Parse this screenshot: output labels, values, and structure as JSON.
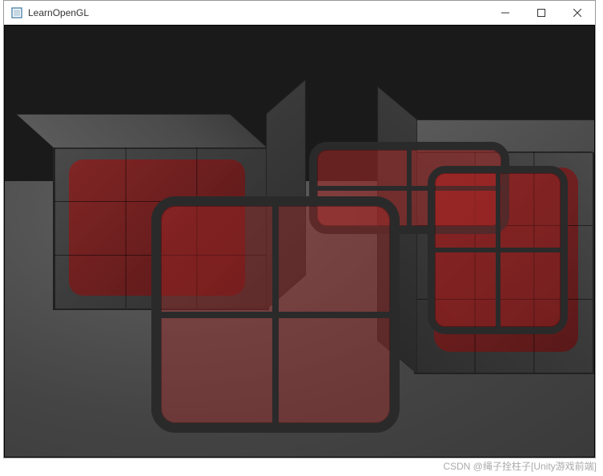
{
  "window": {
    "title": "LearnOpenGL",
    "controls": {
      "minimize": "—",
      "maximize": "☐",
      "close": "✕"
    }
  },
  "scene": {
    "background_color": "#1a1a1a",
    "floor_color": "#555555",
    "cube_texture_color": "#3a3a3a",
    "glass_color": "rgba(165,40,40,0.42)",
    "frame_color": "#2a2a2a"
  },
  "watermark": "CSDN @绳子拴柱子[Unity游戏前端]"
}
